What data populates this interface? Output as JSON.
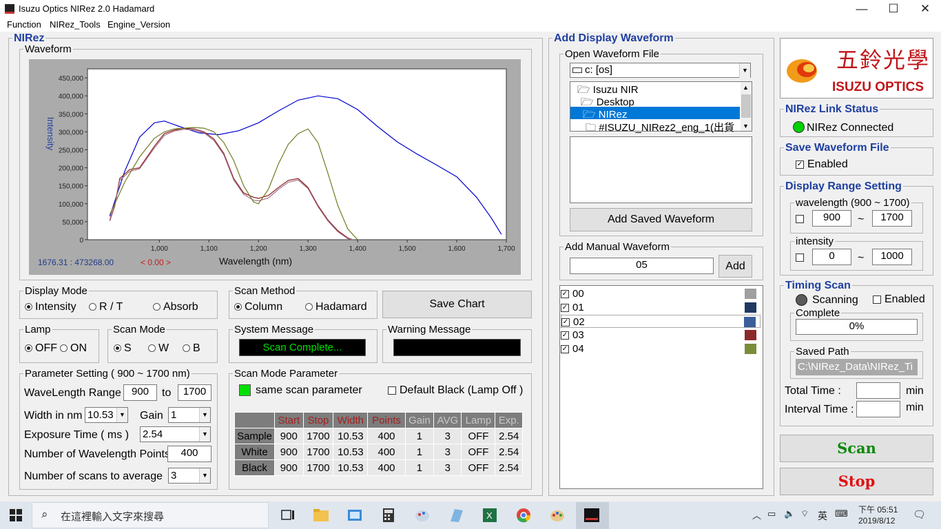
{
  "window": {
    "title": "Isuzu Optics NIRez 2.0 Hadamard",
    "minimize": "—",
    "maximize": "☐",
    "close": "✕"
  },
  "menu": [
    "Function",
    "NIRez_Tools",
    "Engine_Version"
  ],
  "nirez_group": "NIRez",
  "waveform_group": "Waveform",
  "chart_data": {
    "type": "line",
    "xlabel": "Wavelength (nm)",
    "ylabel": "Intensity",
    "xlim": [
      900,
      1700
    ],
    "ylim": [
      0,
      475000
    ],
    "xticks": [
      1000,
      1100,
      1200,
      1300,
      1400,
      1500,
      1600,
      1700
    ],
    "xtick_labels": [
      "1,000",
      "1,100",
      "1,200",
      "1,300",
      "1,400",
      "1,500",
      "1,600",
      "1,700"
    ],
    "yticks": [
      0,
      50000,
      100000,
      150000,
      200000,
      250000,
      300000,
      350000,
      400000,
      450000
    ],
    "ytick_labels": [
      "0",
      "50,000",
      "100,000",
      "150,000",
      "200,000",
      "250,000",
      "300,000",
      "350,000",
      "400,000",
      "450,000"
    ],
    "grid": false,
    "series": [
      {
        "color": "#0000cc",
        "x": [
          900,
          930,
          960,
          990,
          1010,
          1040,
          1080,
          1120,
          1160,
          1200,
          1240,
          1280,
          1320,
          1360,
          1400,
          1440,
          1480,
          1520,
          1560,
          1600,
          1640,
          1670,
          1690
        ],
        "y": [
          65000,
          190000,
          285000,
          325000,
          330000,
          315000,
          297000,
          292000,
          303000,
          325000,
          358000,
          388000,
          400000,
          392000,
          362000,
          315000,
          272000,
          238000,
          207000,
          175000,
          118000,
          60000,
          15000
        ]
      },
      {
        "color": "#8b1a1a",
        "x": [
          900,
          910,
          920,
          940,
          960,
          990,
          1010,
          1030,
          1050,
          1070,
          1090,
          1110,
          1130,
          1150,
          1170,
          1190,
          1200,
          1220,
          1240,
          1260,
          1280,
          1300,
          1320,
          1340,
          1360,
          1380,
          1390
        ],
        "y": [
          55000,
          95000,
          170000,
          195000,
          200000,
          260000,
          295000,
          305000,
          310000,
          308000,
          300000,
          280000,
          240000,
          170000,
          130000,
          118000,
          115000,
          123000,
          145000,
          165000,
          170000,
          145000,
          95000,
          55000,
          25000,
          5000,
          0
        ]
      },
      {
        "color": "#a0708a",
        "x": [
          900,
          910,
          920,
          940,
          960,
          990,
          1010,
          1030,
          1050,
          1070,
          1090,
          1110,
          1130,
          1150,
          1170,
          1190,
          1200,
          1220,
          1240,
          1260,
          1280,
          1300,
          1320,
          1340,
          1360,
          1380,
          1390
        ],
        "y": [
          52000,
          92000,
          165000,
          190000,
          197000,
          255000,
          290000,
          302000,
          307000,
          305000,
          297000,
          276000,
          236000,
          166000,
          126000,
          110000,
          108000,
          116000,
          140000,
          160000,
          166000,
          142000,
          92000,
          52000,
          22000,
          3000,
          0
        ]
      },
      {
        "color": "#707a20",
        "x": [
          900,
          930,
          960,
          990,
          1010,
          1030,
          1050,
          1070,
          1090,
          1110,
          1130,
          1150,
          1170,
          1190,
          1200,
          1220,
          1240,
          1260,
          1280,
          1300,
          1320,
          1340,
          1360,
          1380,
          1400
        ],
        "y": [
          70000,
          160000,
          230000,
          282000,
          300000,
          308000,
          310000,
          312000,
          310000,
          300000,
          270000,
          220000,
          150000,
          105000,
          100000,
          140000,
          210000,
          265000,
          295000,
          308000,
          270000,
          185000,
          95000,
          30000,
          0
        ]
      }
    ]
  },
  "chart_footer": {
    "cursor": "1676.31 : 473268.00",
    "delta": "< 0.00 >"
  },
  "display_mode": {
    "label": "Display Mode",
    "options": [
      "Intensity",
      "R / T",
      "Absorb"
    ],
    "selected": 0
  },
  "scan_method": {
    "label": "Scan Method",
    "options": [
      "Column",
      "Hadamard"
    ],
    "selected": 0
  },
  "save_chart": "Save Chart",
  "lamp": {
    "label": "Lamp",
    "options": [
      "OFF",
      "ON"
    ],
    "selected": 0
  },
  "scan_mode": {
    "label": "Scan Mode",
    "options": [
      "S",
      "W",
      "B"
    ],
    "selected": 0
  },
  "system_message": {
    "label": "System Message",
    "text": "Scan Complete..."
  },
  "warning_message": {
    "label": "Warning Message",
    "text": ""
  },
  "parameter": {
    "label": "Parameter Setting ( 900 ~ 1700 nm)",
    "wl_range": "WaveLength Range",
    "wl_from": "900",
    "to": "to",
    "wl_to": "1700",
    "width_label": "Width in nm",
    "width": "10.53",
    "gain_label": "Gain",
    "gain": "1",
    "exposure_label": "Exposure Time ( ms )",
    "exposure": "2.54",
    "points_label": "Number of Wavelength Points",
    "points": "400",
    "scans_label": "Number of scans to average",
    "scans": "3"
  },
  "scan_param": {
    "label": "Scan Mode Parameter",
    "same": "same scan parameter",
    "default_black": "Default Black (Lamp Off )",
    "headers": [
      "",
      "Start",
      "Stop",
      "Width",
      "Points",
      "Gain",
      "AVG",
      "Lamp",
      "Exp."
    ],
    "rows": [
      [
        "Sample",
        "900",
        "1700",
        "10.53",
        "400",
        "1",
        "3",
        "OFF",
        "2.54"
      ],
      [
        "White",
        "900",
        "1700",
        "10.53",
        "400",
        "1",
        "3",
        "OFF",
        "2.54"
      ],
      [
        "Black",
        "900",
        "1700",
        "10.53",
        "400",
        "1",
        "3",
        "OFF",
        "2.54"
      ]
    ]
  },
  "add_display": {
    "label": "Add Display Waveform",
    "open_file": "Open Waveform File",
    "drive": "c: [os]",
    "folders": [
      "Isuzu NIR",
      "Desktop",
      "NIRez",
      "#ISUZU_NIRez2_eng_1(出貨"
    ],
    "add_saved": "Add Saved Waveform",
    "manual_label": "Add Manual Waveform",
    "manual_value": "05",
    "add": "Add"
  },
  "waveform_list": [
    {
      "name": "00",
      "color": "#a0a0a0"
    },
    {
      "name": "01",
      "color": "#1f3a63"
    },
    {
      "name": "02",
      "color": "#3b5f9a"
    },
    {
      "name": "03",
      "color": "#8b2a2a"
    },
    {
      "name": "04",
      "color": "#7a8e3a"
    }
  ],
  "logo": {
    "cn": "五鈴光學",
    "en": "ISUZU OPTICS"
  },
  "link_status": {
    "label": "NIRez Link Status",
    "text": "NIRez Connected"
  },
  "save_file": {
    "label": "Save Waveform File",
    "text": "Enabled"
  },
  "display_range": {
    "label": "Display Range Setting",
    "wl_label": "wavelength (900 ~ 1700)",
    "wl_from": "900",
    "wl_to": "1700",
    "int_label": "intensity",
    "int_from": "0",
    "int_to": "1000",
    "tilde": "~"
  },
  "timing": {
    "label": "Timing Scan",
    "scanning": "Scanning",
    "enabled": "Enabled",
    "complete_label": "Complete",
    "complete": "0%",
    "saved_label": "Saved Path",
    "saved": "C:\\NIRez_Data\\NIRez_Ti",
    "total": "Total    Time :",
    "interval": "Interval Time :",
    "min": "min"
  },
  "scan_btn": "Scan",
  "stop_btn": "Stop",
  "taskbar": {
    "search": "在這裡輸入文字來搜尋",
    "ime": "英",
    "time": "下午 05:51",
    "date": "2019/8/12"
  }
}
